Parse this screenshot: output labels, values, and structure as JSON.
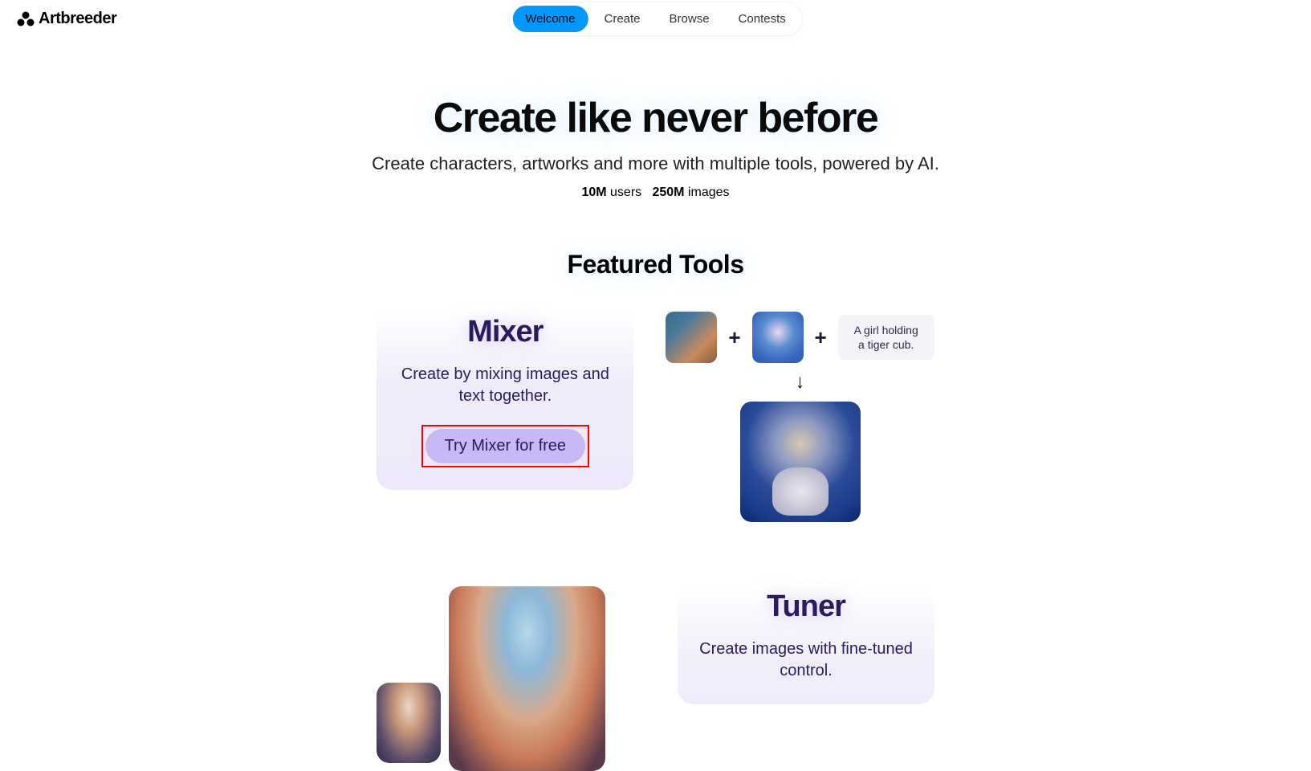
{
  "brand": "Artbreeder",
  "nav": {
    "items": [
      {
        "label": "Welcome",
        "active": true
      },
      {
        "label": "Create",
        "active": false
      },
      {
        "label": "Browse",
        "active": false
      },
      {
        "label": "Contests",
        "active": false
      }
    ]
  },
  "hero": {
    "title": "Create like never before",
    "subtitle": "Create characters, artworks and more with multiple tools, powered by AI.",
    "stats": {
      "users_count": "10M",
      "users_label": "users",
      "images_count": "250M",
      "images_label": "images"
    }
  },
  "featured": {
    "title": "Featured Tools"
  },
  "mixer": {
    "title": "Mixer",
    "description": "Create by mixing images and text together.",
    "cta": "Try Mixer for free",
    "prompt": "A girl holding a tiger cub.",
    "plus": "+",
    "arrow": "↓"
  },
  "tuner": {
    "title": "Tuner",
    "description": "Create images with fine-tuned control."
  }
}
